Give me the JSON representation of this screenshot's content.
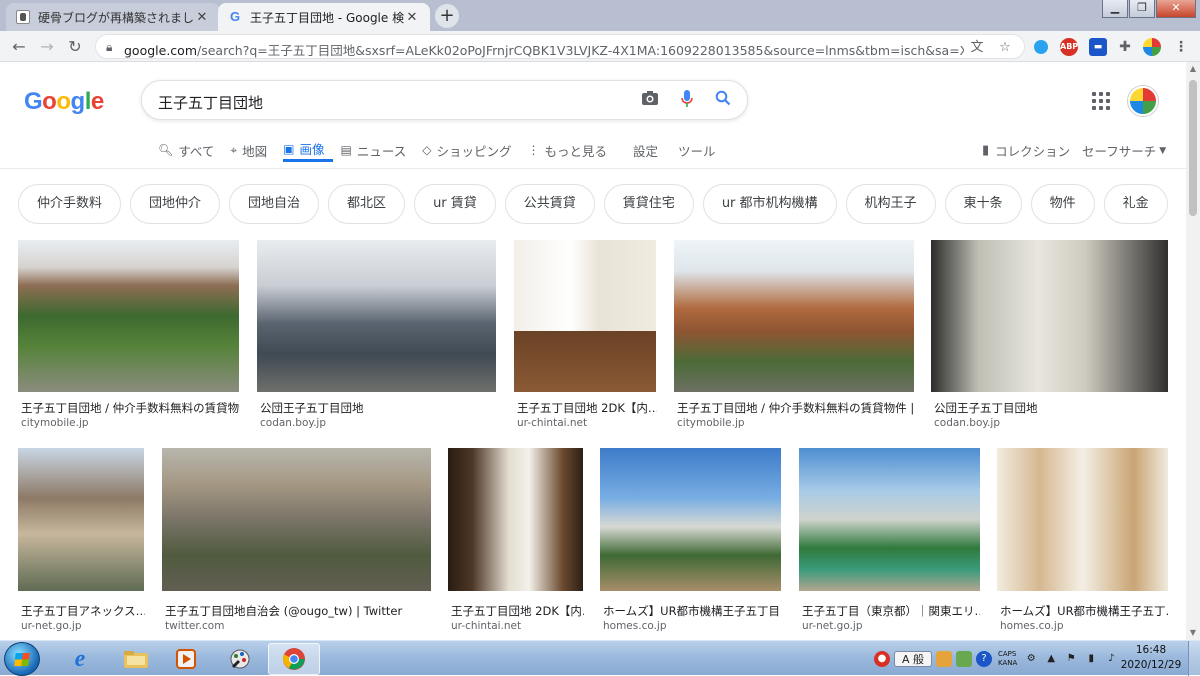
{
  "browser": {
    "tabs": [
      {
        "title": "硬骨ブログが再構築されました",
        "active": false
      },
      {
        "title": "王子五丁目団地 - Google 検索",
        "active": true
      }
    ],
    "new_tab_symbol": "+",
    "close_symbol": "✕",
    "url_host": "google.com",
    "url_rest": "/search?q=王子五丁目団地&sxsrf=ALeKk02oPoJFrnjrCQBK1V3LVJKZ-4X1MA:1609228013585&source=lnms&tbm=isch&sa=X…",
    "ext_abp_label": "ABP"
  },
  "google": {
    "logo_letters": [
      "G",
      "o",
      "o",
      "g",
      "l",
      "e"
    ],
    "query": "王子五丁目団地",
    "tabs": [
      {
        "icon": "search-icon",
        "label": "すべて",
        "active": false
      },
      {
        "icon": "pin-icon",
        "label": "地図",
        "active": false
      },
      {
        "icon": "image-icon",
        "label": "画像",
        "active": true
      },
      {
        "icon": "news-icon",
        "label": "ニュース",
        "active": false
      },
      {
        "icon": "tag-icon",
        "label": "ショッピング",
        "active": false
      },
      {
        "icon": "more-icon",
        "label": "もっと見る",
        "active": false
      }
    ],
    "settings_label": "設定",
    "tools_label": "ツール",
    "collections_label": "コレクション",
    "safesearch_label": "セーフサーチ",
    "chips": [
      "仲介手数料",
      "団地仲介",
      "団地自治",
      "都北区",
      "ur 賃貸",
      "公共賃貸",
      "賃貸住宅",
      "ur 都市机构機構",
      "机构王子",
      "東十条",
      "物件",
      "礼金"
    ],
    "accent_color": "#1a73e8"
  },
  "results_row1": [
    {
      "title": "王子五丁目団地 / 仲介手数料無料の賃貸物…",
      "source": "citymobile.jp"
    },
    {
      "title": "公団王子五丁目団地",
      "source": "codan.boy.jp"
    },
    {
      "title": "王子五丁目団地 2DK【内…",
      "source": "ur-chintai.net"
    },
    {
      "title": "王子五丁目団地 / 仲介手数料無料の賃貸物件 | …",
      "source": "citymobile.jp"
    },
    {
      "title": "公団王子五丁目団地",
      "source": "codan.boy.jp"
    }
  ],
  "results_row2": [
    {
      "title": "王子五丁目アネックス…",
      "source": "ur-net.go.jp"
    },
    {
      "title": "王子五丁目団地自治会 (@ougo_tw) | Twitter",
      "source": "twitter.com"
    },
    {
      "title": "王子五丁目団地 2DK【内…",
      "source": "ur-chintai.net"
    },
    {
      "title": "ホームズ】UR都市機構王子五丁目…",
      "source": "homes.co.jp"
    },
    {
      "title": "王子五丁目（東京都）｜関東エリ…",
      "source": "ur-net.go.jp"
    },
    {
      "title": "ホームズ】UR都市機構王子五丁…",
      "source": "homes.co.jp"
    }
  ],
  "taskbar": {
    "ime_label": "A 般",
    "caps_label": "CAPS",
    "kana_label": "KANA",
    "time": "16:48",
    "date": "2020/12/29"
  }
}
